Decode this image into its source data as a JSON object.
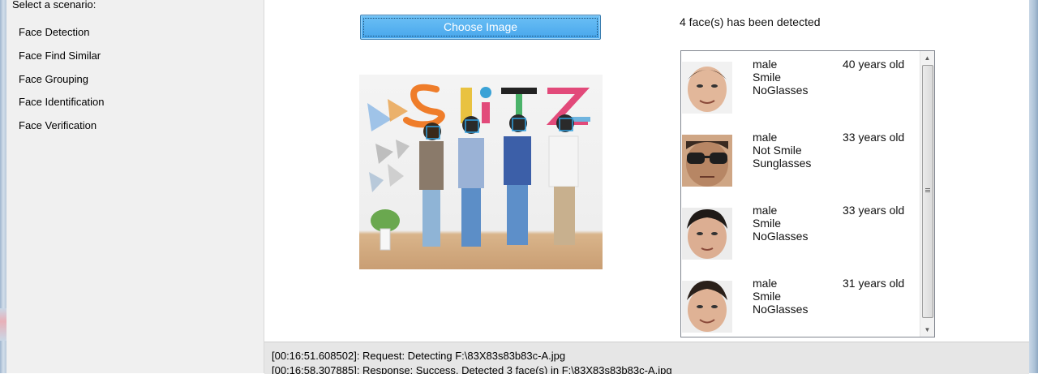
{
  "sidebar": {
    "heading": "Select a scenario:",
    "items": [
      {
        "label": "Face Detection"
      },
      {
        "label": "Face Find Similar"
      },
      {
        "label": "Face Grouping"
      },
      {
        "label": "Face Identification"
      },
      {
        "label": "Face Verification"
      }
    ]
  },
  "main": {
    "choose_button": "Choose Image",
    "detected_text": "4 face(s) has been detected",
    "faces": [
      {
        "gender": "male",
        "smile": "Smile",
        "glasses": "NoGlasses",
        "age": "40 years old"
      },
      {
        "gender": "male",
        "smile": "Not Smile",
        "glasses": "Sunglasses",
        "age": "33 years old"
      },
      {
        "gender": "male",
        "smile": "Smile",
        "glasses": "NoGlasses",
        "age": "33 years old"
      },
      {
        "gender": "male",
        "smile": "Smile",
        "glasses": "NoGlasses",
        "age": "31 years old"
      }
    ]
  },
  "log": {
    "lines": [
      "[00:16:51.608502]: Request: Detecting F:\\83X83s83b83c-A.jpg",
      "[00:16:58.307885]: Response: Success. Detected 3 face(s) in F:\\83X83s83b83c-A.jpg"
    ]
  },
  "colors": {
    "button_blue": "#47a6ec",
    "sidebar_bg": "#f0f0f0",
    "log_bg": "#e6e6e6",
    "face_box": "#2fa0e0"
  },
  "icons": {
    "scroll_up": "scroll-up-arrow-icon",
    "scroll_down": "scroll-down-arrow-icon",
    "scroll_grip": "grip-icon"
  }
}
